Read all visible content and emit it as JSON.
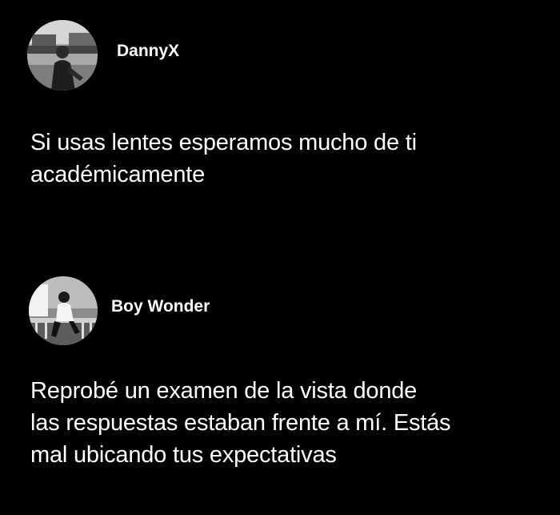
{
  "posts": [
    {
      "username": "DannyX",
      "avatar_icon": "user-photo-avatar",
      "lines": [
        "Si usas lentes esperamos mucho de ti",
        "académicamente"
      ]
    },
    {
      "username": "Boy Wonder",
      "avatar_icon": "user-photo-avatar",
      "lines": [
        "Reprobé un examen de la vista donde",
        "las respuestas estaban frente a mí. Estás",
        "mal ubicando tus expectativas"
      ]
    }
  ],
  "colors": {
    "background": "#000000",
    "text": "#ffffff"
  }
}
